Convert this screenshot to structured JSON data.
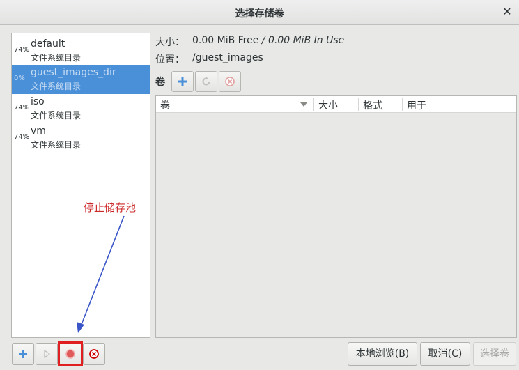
{
  "window": {
    "title": "选择存储卷",
    "close_glyph": "✕"
  },
  "pools": [
    {
      "pct": "74%",
      "name": "default",
      "type": "文件系统目录",
      "selected": false
    },
    {
      "pct": "0%",
      "name": "guest_images_dir",
      "type": "文件系统目录",
      "selected": true
    },
    {
      "pct": "74%",
      "name": "iso",
      "type": "文件系统目录",
      "selected": false
    },
    {
      "pct": "74%",
      "name": "vm",
      "type": "文件系统目录",
      "selected": false
    }
  ],
  "info": {
    "size_label": "大小：",
    "size_free": "0.00 MiB Free",
    "size_sep": " / ",
    "size_in_use": "0.00 MiB In Use",
    "location_label": "位置：",
    "location_value": "/guest_images"
  },
  "volumes": {
    "label": "卷",
    "columns": [
      "卷",
      "大小",
      "格式",
      "用于"
    ],
    "rows": []
  },
  "annotation": {
    "text": "停止储存池",
    "color": "#cc2a2a"
  },
  "buttons": {
    "browse_local": "本地浏览(B)",
    "cancel": "取消(C)",
    "choose_volume": "选择卷"
  },
  "colors": {
    "selection": "#4a90d9",
    "add": "#4a90d9",
    "stop": "#e05a5a",
    "delete": "#cc0000"
  },
  "icons": {
    "add_pool": "plus-icon",
    "start_pool": "play-icon",
    "stop_pool": "stop-icon",
    "delete_pool": "delete-icon",
    "add_volume": "plus-icon",
    "refresh_volume": "refresh-icon",
    "delete_volume": "delete-icon"
  }
}
